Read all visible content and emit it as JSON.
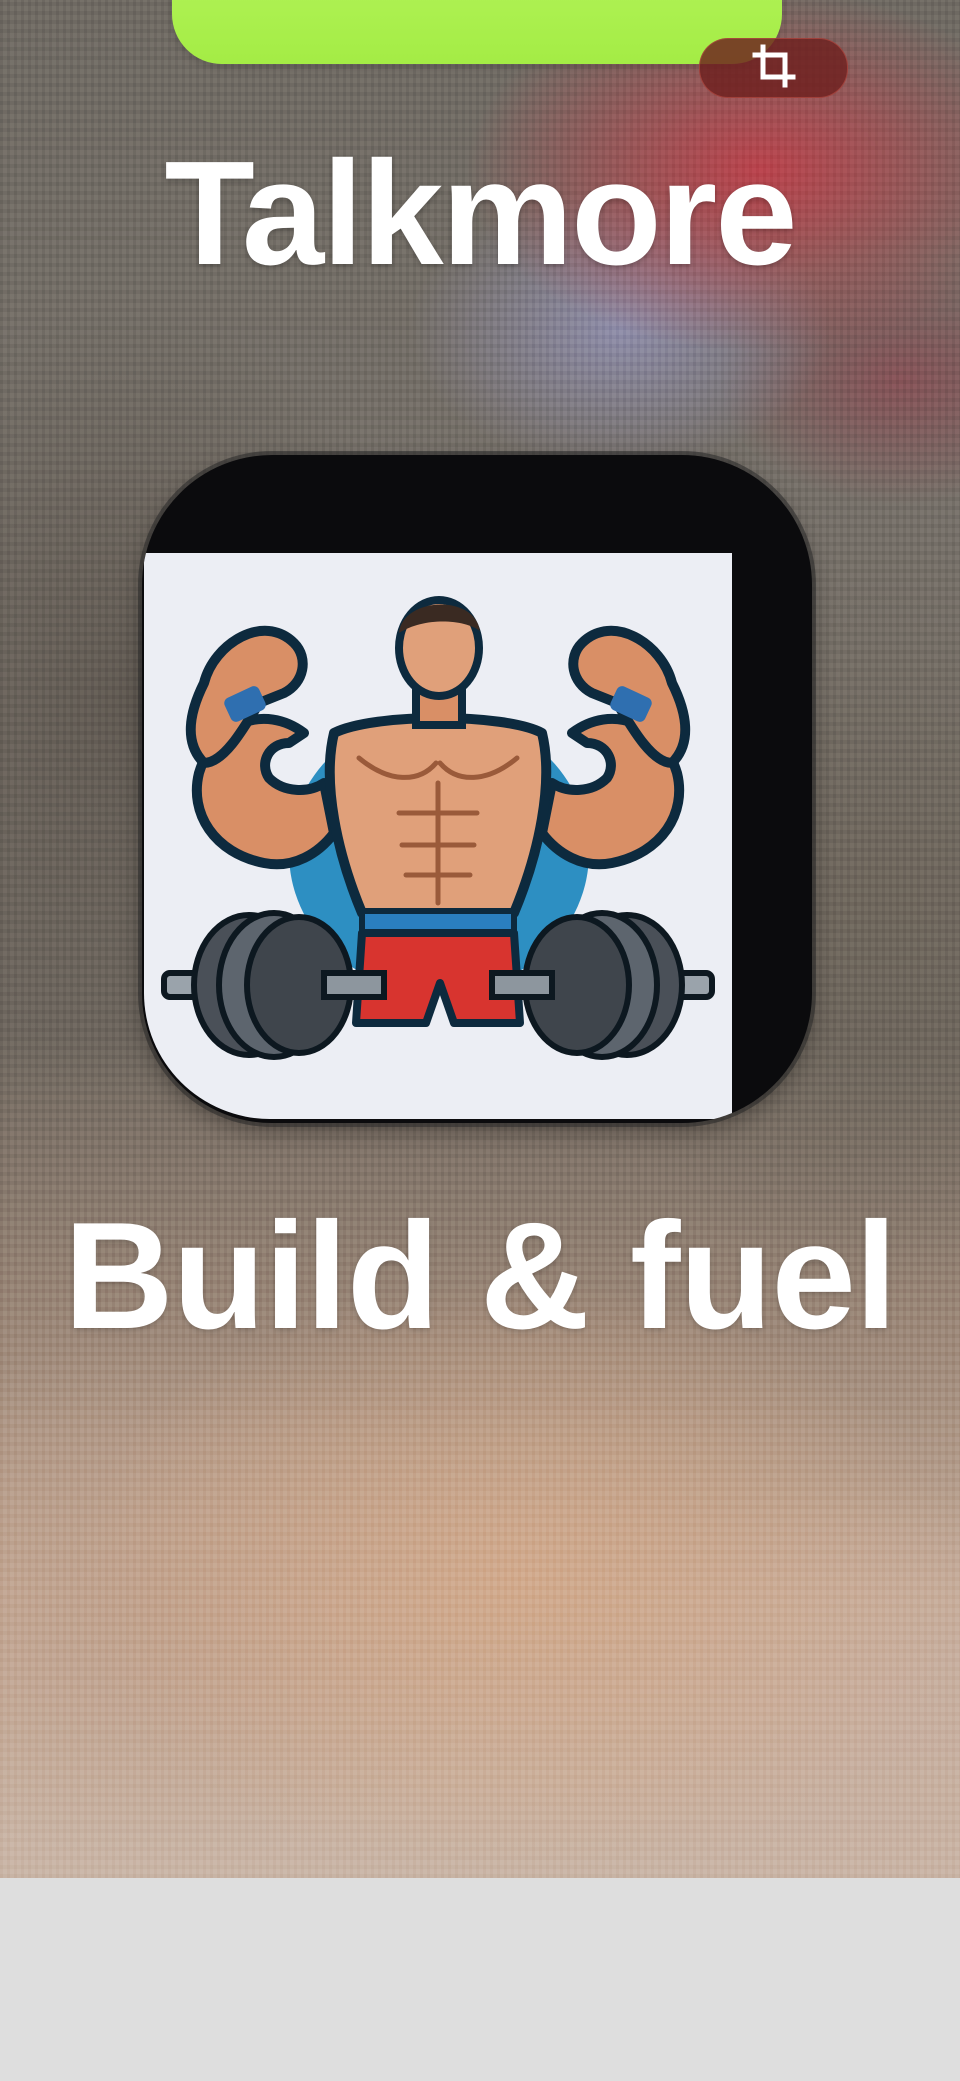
{
  "title": "Talkmore",
  "subtitle": "Build & fuel",
  "crop_button": {
    "icon": "crop-icon"
  },
  "app_icon": {
    "icon": "bodybuilder-dumbbell-logo"
  },
  "colors": {
    "green_pill": "#a8ee4a",
    "crop_button_bg": "#6e201e",
    "text": "#ffffff",
    "bottom_bar": "#dedede"
  }
}
